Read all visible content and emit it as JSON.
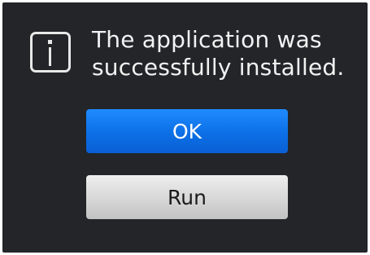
{
  "dialog": {
    "icon": "info-icon",
    "message_line1": "The application was",
    "message_line2": "successfully installed."
  },
  "buttons": {
    "ok_label": "OK",
    "run_label": "Run"
  },
  "colors": {
    "dialog_background": "#232529",
    "primary_button": "#0c6fe6",
    "secondary_button": "#d9d9d9",
    "text": "#f2f2f2"
  }
}
